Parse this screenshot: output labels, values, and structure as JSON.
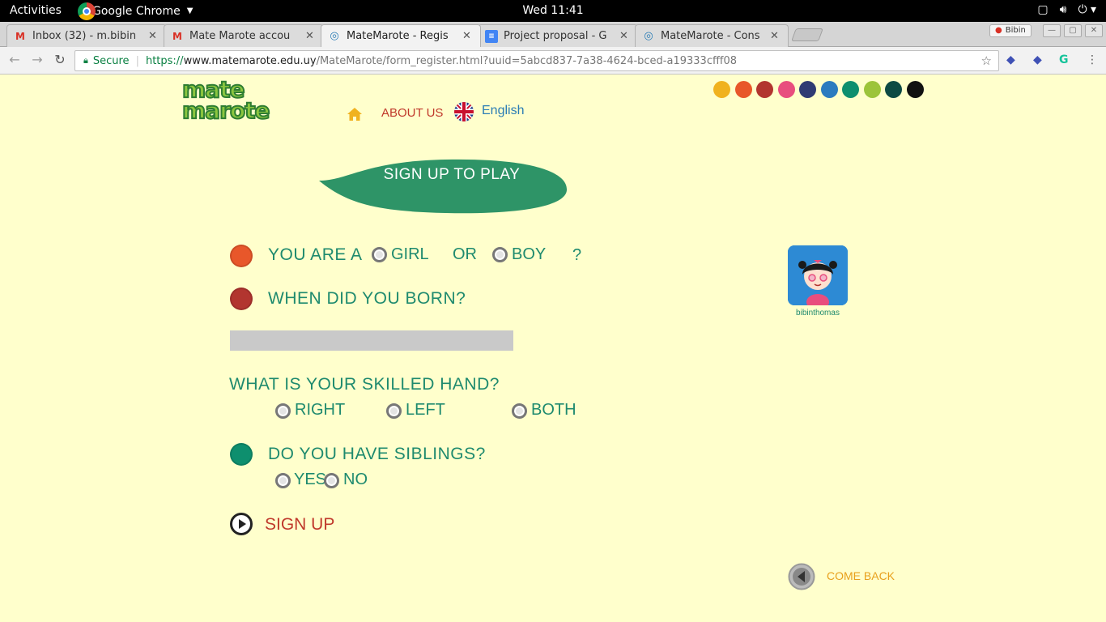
{
  "system_bar": {
    "activities": "Activities",
    "app_name": "Google Chrome",
    "clock": "Wed 11:41"
  },
  "tabs": [
    {
      "title": "Inbox (32) - m.bibin",
      "icon": "gmail-icon",
      "active": false
    },
    {
      "title": "Mate Marote accou",
      "icon": "gmail-icon",
      "active": false
    },
    {
      "title": "MateMarote - Regis",
      "icon": "matemarote-icon",
      "active": true
    },
    {
      "title": "Project proposal - G",
      "icon": "docs-icon",
      "active": false
    },
    {
      "title": "MateMarote - Cons",
      "icon": "matemarote-icon",
      "active": false
    }
  ],
  "profile_label": "Bibin",
  "omnibox": {
    "secure_label": "Secure",
    "scheme": "https://",
    "host": "www.matemarote.edu.uy",
    "path": "/MateMarote/form_register.html?uuid=5abcd837-7a38-4624-bced-a19333cfff08"
  },
  "site": {
    "logo_line1": "mate",
    "logo_line2": "marote",
    "nav_about": "ABOUT US",
    "nav_language": "English",
    "swatch_colors": [
      "#f0b21f",
      "#e8572a",
      "#b2352f",
      "#e84e7e",
      "#2f3b73",
      "#2b7bbf",
      "#0e8f6e",
      "#9cc43a",
      "#0d4a43",
      "#111111"
    ]
  },
  "form": {
    "banner": "SIGN UP TO PLAY",
    "q_gender": "YOU ARE A",
    "opt_girl": "GIRL",
    "word_or": "OR",
    "opt_boy": "BOY",
    "question_mark": "?",
    "q_birth": "WHEN DID YOU BORN?",
    "birth_value": "",
    "q_hand": "WHAT IS YOUR SKILLED HAND?",
    "opt_right": "RIGHT",
    "opt_left": "LEFT",
    "opt_both": "BOTH",
    "q_siblings": "DO YOU HAVE SIBLINGS?",
    "opt_yes": "YES",
    "opt_no": "NO",
    "signup": "SIGN UP"
  },
  "user": {
    "username": "bibinthomas"
  },
  "come_back": "COME BACK",
  "colors": {
    "page_bg": "#ffffcc",
    "banner": "#2e9467",
    "question_text": "#1e8a6e",
    "accent_red": "#c0392b",
    "accent_orange": "#e8a01c"
  }
}
